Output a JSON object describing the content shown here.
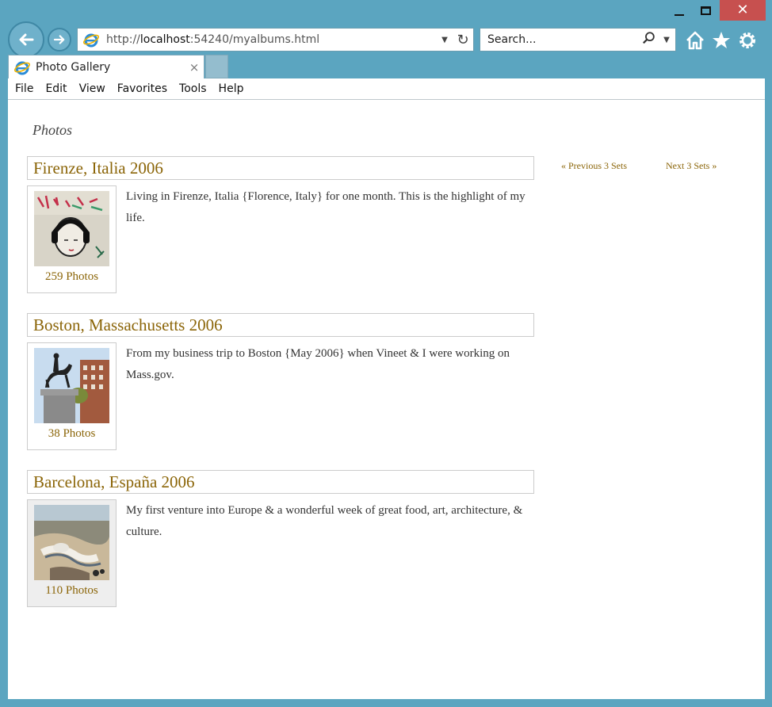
{
  "browser": {
    "url_prefix": "http://",
    "url_host": "localhost",
    "url_rest": ":54240/myalbums.html",
    "search_placeholder": "Search...",
    "tab_title": "Photo Gallery",
    "tab_close": "×",
    "close_glyph": "✕",
    "menu": [
      "File",
      "Edit",
      "View",
      "Favorites",
      "Tools",
      "Help"
    ],
    "icons": [
      "back-icon",
      "forward-icon",
      "ie-icon",
      "refresh-icon",
      "search-icon",
      "home-icon",
      "star-icon",
      "gear-icon"
    ]
  },
  "page": {
    "heading": "Photos",
    "prev_label": "« Previous 3 Sets",
    "next_label": "Next 3 Sets »",
    "albums": [
      {
        "title": "Firenze, Italia 2006",
        "count": "259 Photos",
        "description": "Living in Firenze, Italia {Florence, Italy} for one month. This is the highlight of my life."
      },
      {
        "title": "Boston, Massachusetts 2006",
        "count": "38 Photos",
        "description": "From my business trip to Boston {May 2006} when Vineet & I were working on Mass.gov."
      },
      {
        "title": "Barcelona, España 2006",
        "count": "110 Photos",
        "description": "My first venture into Europe & a wonderful week of great food, art, architecture, & culture."
      }
    ]
  },
  "colors": {
    "frame": "#5ba5c0",
    "link": "#8b6508",
    "close_button": "#c7504f"
  }
}
